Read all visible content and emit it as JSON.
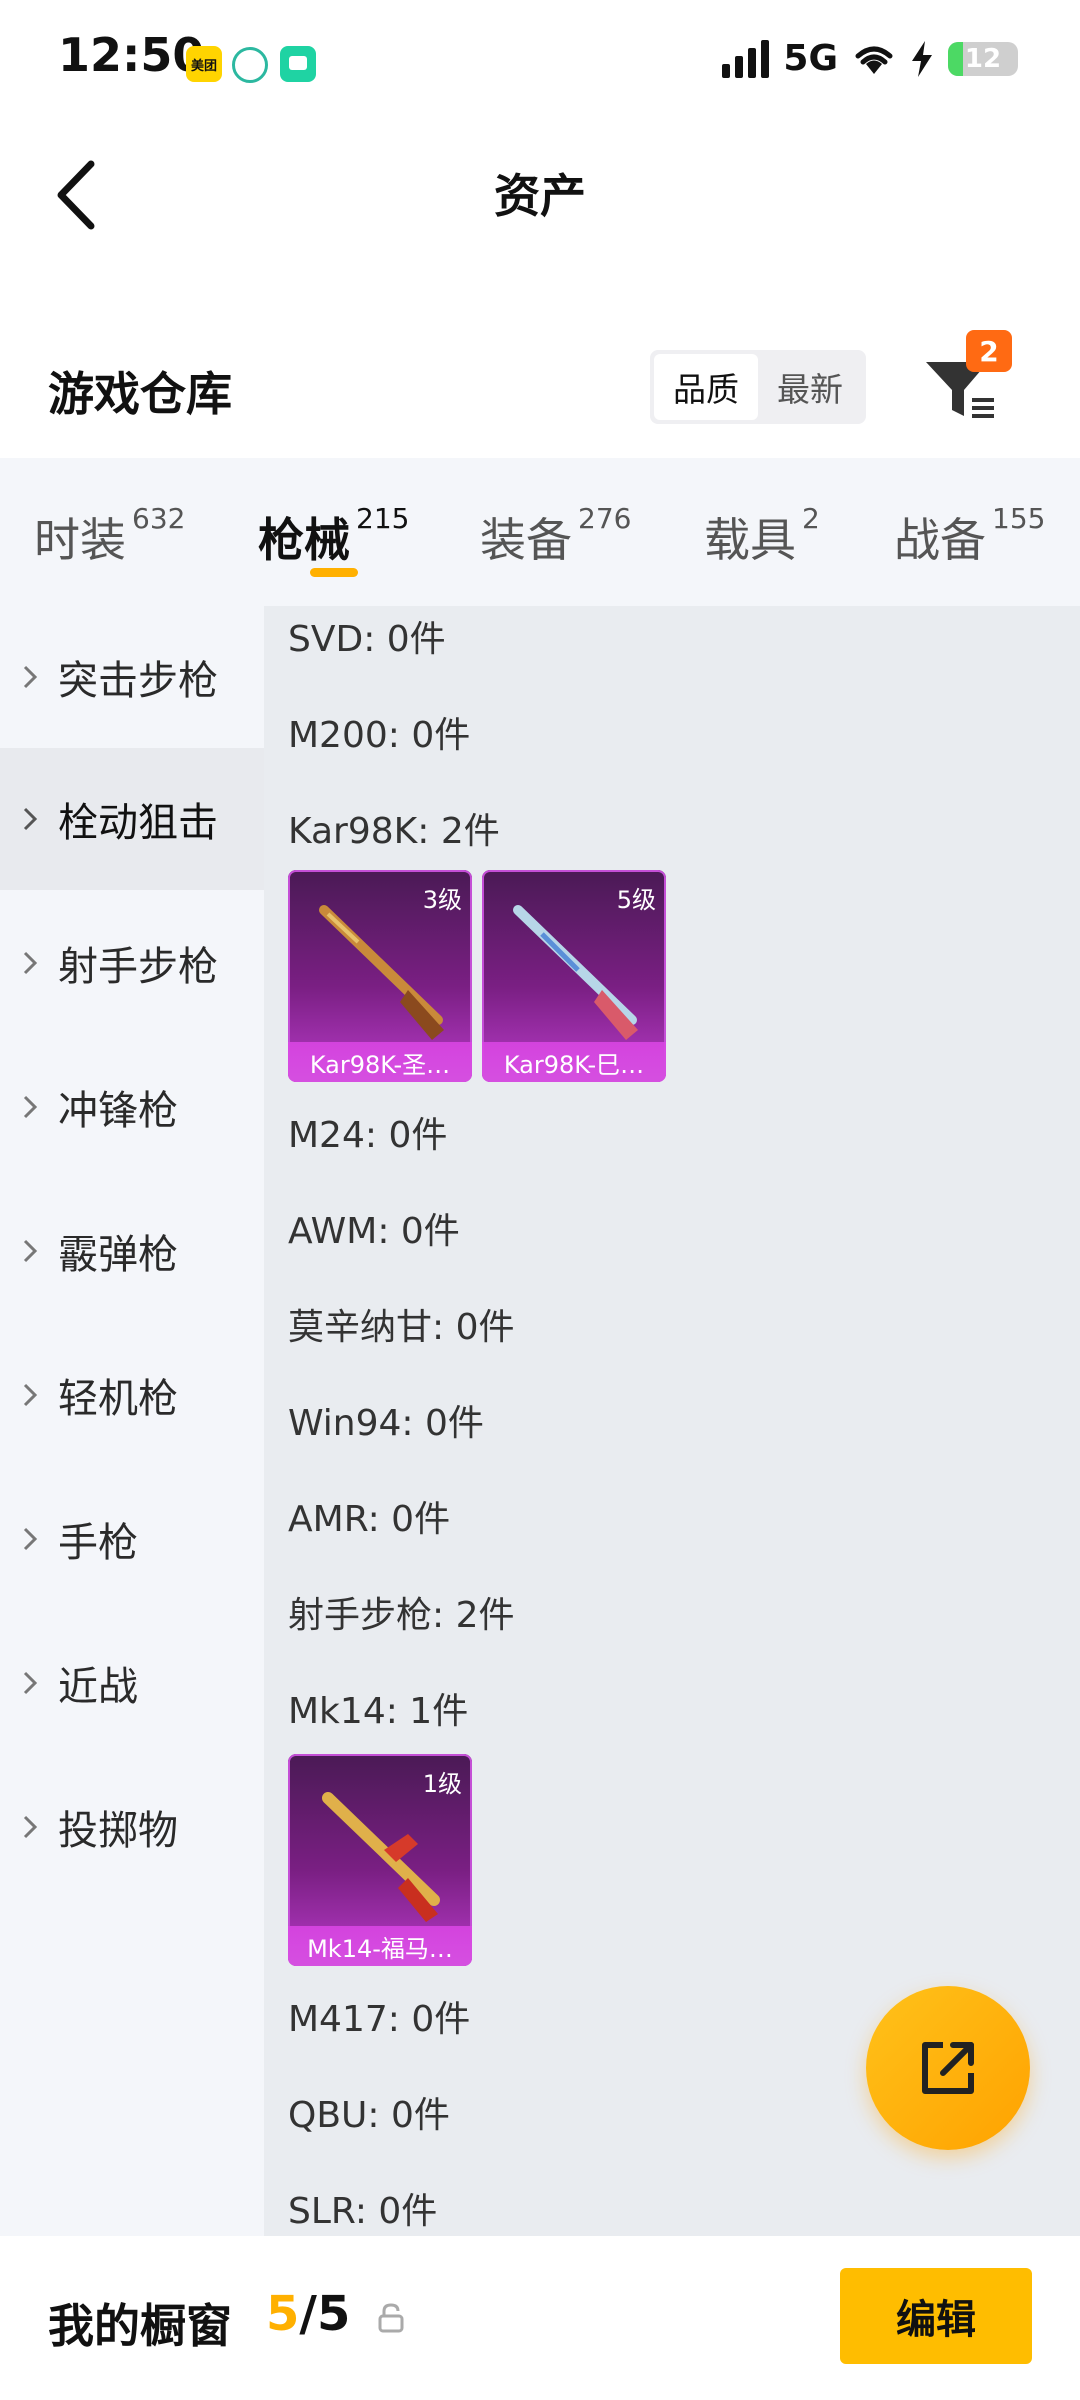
{
  "status_bar": {
    "time": "12:50",
    "network": "5G",
    "battery": "12",
    "app_icons": [
      "meituan-icon",
      "leaf-icon",
      "chat-icon"
    ],
    "app_icon_text": "美团"
  },
  "header": {
    "title": "资产"
  },
  "warehouse": {
    "title": "游戏仓库",
    "sort_options": [
      "品质",
      "最新"
    ],
    "filter_badge": "2"
  },
  "tabs": [
    {
      "label": "时装",
      "count": "632"
    },
    {
      "label": "枪械",
      "count": "215"
    },
    {
      "label": "装备",
      "count": "276"
    },
    {
      "label": "载具",
      "count": "2"
    },
    {
      "label": "战备",
      "count": "155"
    }
  ],
  "sidebar": {
    "items": [
      {
        "label": "突击步枪"
      },
      {
        "label": "栓动狙击"
      },
      {
        "label": "射手步枪"
      },
      {
        "label": "冲锋枪"
      },
      {
        "label": "霰弹枪"
      },
      {
        "label": "轻机枪"
      },
      {
        "label": "手枪"
      },
      {
        "label": "近战"
      },
      {
        "label": "投掷物"
      }
    ]
  },
  "content": {
    "rows": [
      "SVD: 0件",
      "M200: 0件",
      "Kar98K: 2件",
      "M24: 0件",
      "AWM: 0件",
      "莫辛纳甘: 0件",
      "Win94: 0件",
      "AMR: 0件",
      "射手步枪: 2件",
      "Mk14: 1件",
      "M417: 0件",
      "QBU: 0件",
      "SLR: 0件"
    ],
    "cards": [
      {
        "level": "3级",
        "name": "Kar98K-圣…"
      },
      {
        "level": "5级",
        "name": "Kar98K-巳…"
      },
      {
        "level": "1级",
        "name": "Mk14-福马…"
      }
    ]
  },
  "bottom_bar": {
    "label": "我的橱窗",
    "current": "5",
    "separator": "/",
    "total": "5",
    "edit_label": "编辑"
  },
  "colors": {
    "accent": "#ffbd00",
    "badge": "#ff6a13",
    "card_purple": "#7a1f83"
  }
}
